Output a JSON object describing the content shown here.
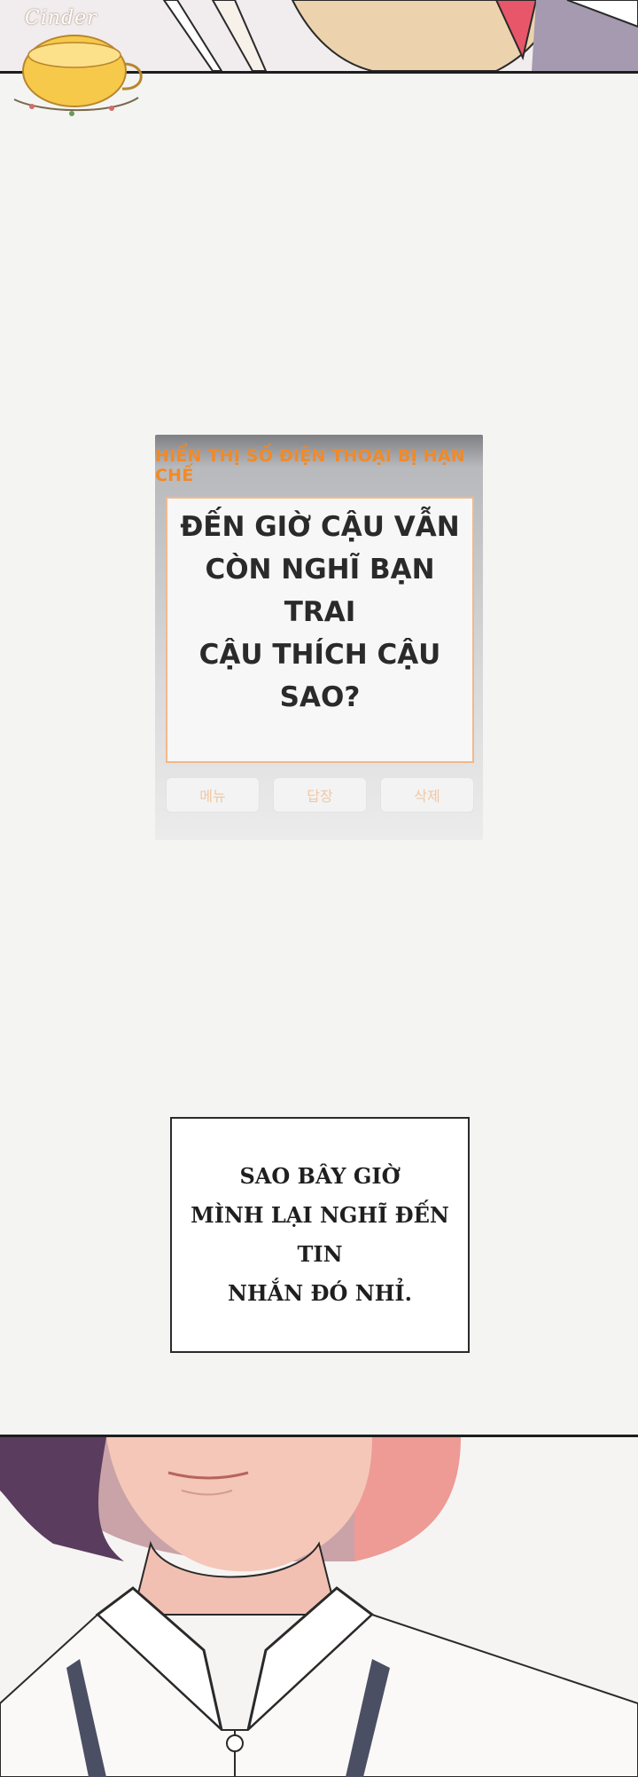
{
  "watermark": {
    "text": "Cinder"
  },
  "phone": {
    "header": "HIỂN THỊ SỐ ĐIỆN THOẠI BỊ HẠN CHẾ",
    "message": "ĐẾN GIỜ CẬU VẪN\nCÒN NGHĨ BẠN TRAI\nCẬU THÍCH CẬU SAO?",
    "buttons": [
      "메뉴",
      "답장",
      "삭제"
    ]
  },
  "caption": {
    "text": "SAO BÂY GIỜ\nMÌNH LẠI NGHĨ ĐẾN TIN\nNHẮN ĐÓ NHỈ."
  },
  "colors": {
    "background": "#f4f4f3",
    "header_orange": "#f08a2a",
    "ink": "#1e1e1e"
  }
}
